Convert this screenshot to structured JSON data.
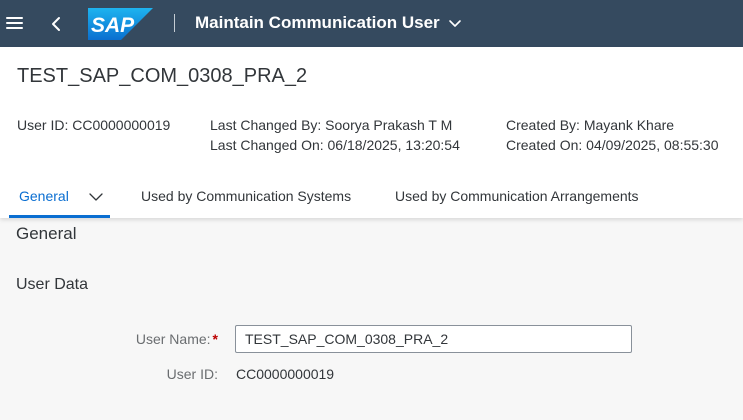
{
  "shell": {
    "logo_text": "SAP",
    "app_title": "Maintain Communication User"
  },
  "header": {
    "object_title": "TEST_SAP_COM_0308_PRA_2",
    "user_id": "User ID: CC0000000019",
    "last_changed_by": "Last Changed By: Soorya Prakash T M",
    "last_changed_on": "Last Changed On: 06/18/2025, 13:20:54",
    "created_by": "Created By: Mayank Khare",
    "created_on": "Created On: 04/09/2025, 08:55:30"
  },
  "tabs": [
    {
      "label": "General"
    },
    {
      "label": "Used by Communication Systems"
    },
    {
      "label": "Used by Communication Arrangements"
    }
  ],
  "content": {
    "section_title": "General",
    "subsection_title": "User Data",
    "user_name_label": "User Name:",
    "required_marker": "*",
    "user_name_value": "TEST_SAP_COM_0308_PRA_2",
    "user_id_label": "User ID:",
    "user_id_value": "CC0000000019"
  },
  "colors": {
    "shell_bg": "#354a5f",
    "accent": "#0a6ed1",
    "required": "#bb0000"
  }
}
